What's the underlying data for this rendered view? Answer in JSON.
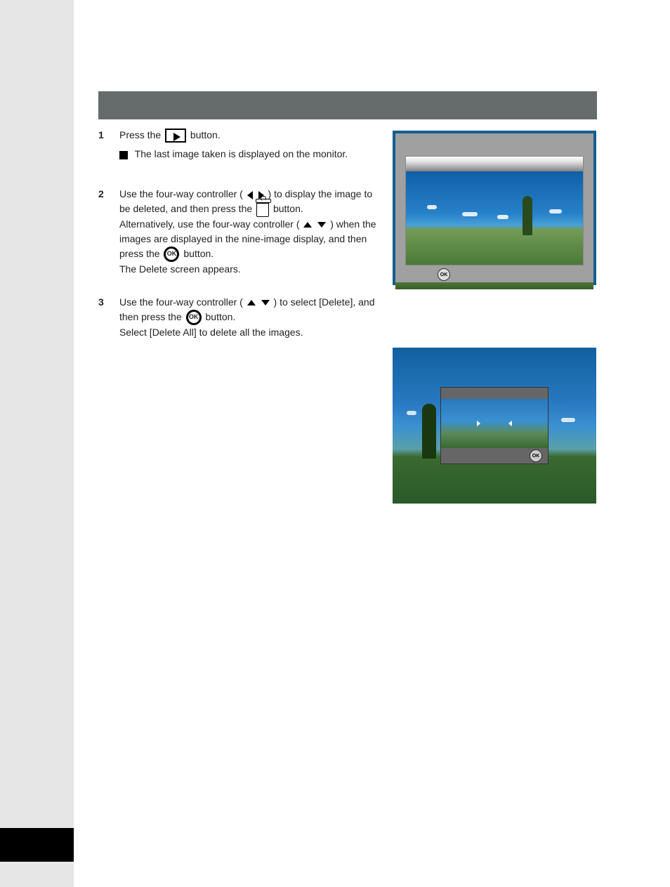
{
  "steps": {
    "s1": {
      "num": "1",
      "text_before": "Press the ",
      "text_after": " button."
    },
    "bullet": {
      "text": "The last image taken is displayed on the monitor."
    },
    "s2": {
      "num": "2",
      "text_p1a": "Use the four-way controller (",
      "text_p1b": ") to display the image to be deleted, and then press the ",
      "text_p1c": " button.",
      "text_p2a": "Alternatively, use the four-way controller (",
      "text_p2b": ") when the images are displayed in the nine-image display, and then press the ",
      "text_p2c": " button.",
      "text_p3": "The Delete screen appears."
    },
    "s3": {
      "num": "3",
      "text_p1a": "Use the four-way controller (",
      "text_p1b": ") to select [Delete], and then press the ",
      "text_p1c": " button.",
      "text_p2": "Select [Delete All] to delete all the images."
    }
  },
  "screenshot1": {
    "ok_label": "OK"
  },
  "screenshot2": {
    "ok_label": "OK"
  }
}
